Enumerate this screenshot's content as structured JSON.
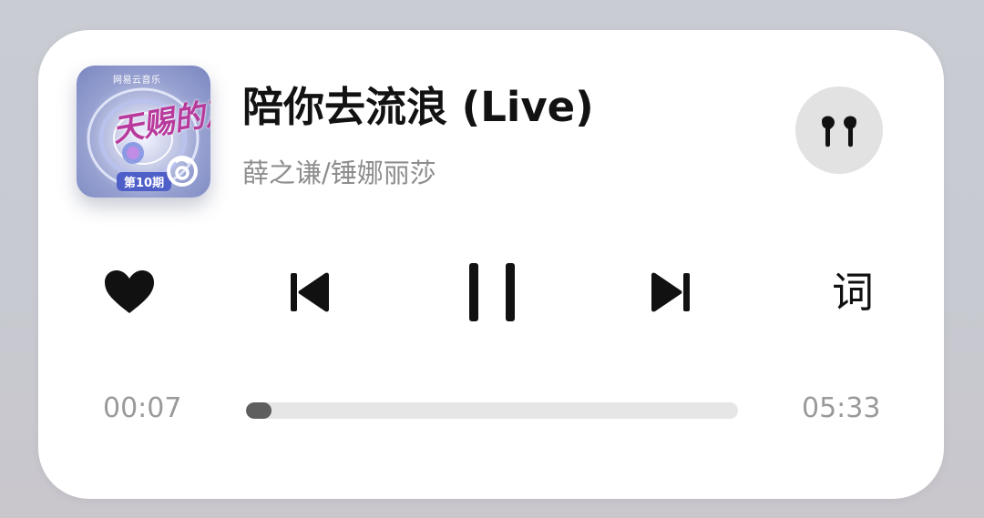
{
  "track": {
    "title": "陪你去流浪 (Live)",
    "artist": "薛之谦/锤娜丽莎"
  },
  "cover": {
    "brand": "网易云音乐",
    "show_title": "天赐的声音",
    "episode": "第10期"
  },
  "device": {
    "icon": "earbuds-icon"
  },
  "controls": {
    "like_icon": "heart-icon",
    "prev_icon": "skip-previous-icon",
    "pause_icon": "pause-icon",
    "next_icon": "skip-next-icon",
    "lyrics_label": "词"
  },
  "progress": {
    "current": "00:07",
    "total": "05:33",
    "fraction": 0.021
  },
  "colors": {
    "title": "#121212",
    "subtitle": "#8e8e8e",
    "progress_fill": "#5e5e5e",
    "progress_track": "#e6e6e6"
  }
}
